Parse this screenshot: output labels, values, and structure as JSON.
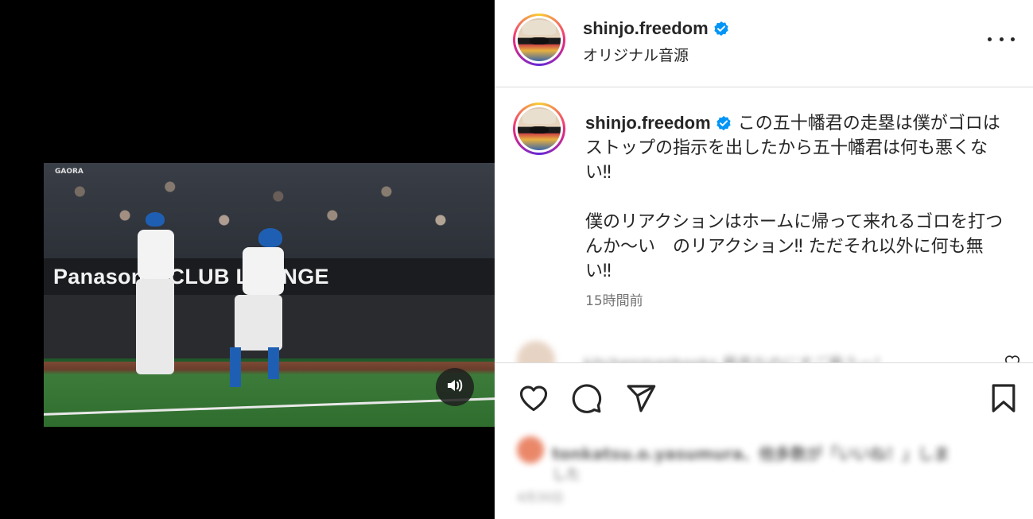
{
  "post": {
    "username": "shinjo.freedom",
    "audio": "オリジナル音源"
  },
  "video": {
    "banner_text": "Panasonic CLUB LOUNGE",
    "channel_logo": "GAORA",
    "mute_icon": "speaker-icon"
  },
  "caption": {
    "username": "shinjo.freedom",
    "text": "この五十幡君の走塁は僕がゴロはストップの指示を出したから五十幡君は何も悪くない‼︎\n\n僕のリアクションはホームに帰って来れるゴロを打つんか〜い　のリアクション‼︎ ただそれ以外に何も無い‼︎",
    "timestamp": "15時間前"
  },
  "blurred_comment": {
    "text": "kitchenmanbooks 最高なのにすご最うー！"
  },
  "likes": {
    "line1": "tonkatsu.o.yasumura、他多数が「いいね！」しま",
    "line2": "した",
    "date": "4月30日"
  },
  "colors": {
    "verified": "#0095f6",
    "text": "#262626",
    "muted": "#737373",
    "divider": "#dbdbdb"
  },
  "icons": {
    "more": "more-horizontal-icon",
    "like": "heart-icon",
    "comment": "comment-icon",
    "share": "send-icon",
    "save": "bookmark-icon"
  }
}
